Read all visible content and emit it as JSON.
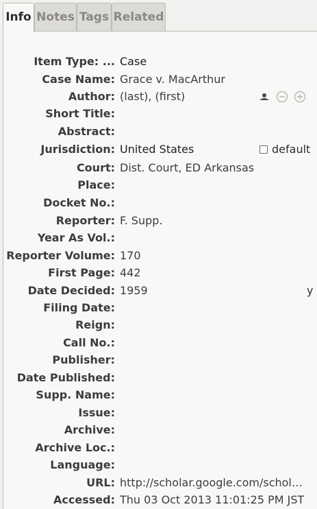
{
  "tabs": [
    {
      "label": "Info"
    },
    {
      "label": "Notes"
    },
    {
      "label": "Tags"
    },
    {
      "label": "Related"
    }
  ],
  "fields": {
    "item_type": {
      "label": "Item Type: ...",
      "value": "Case"
    },
    "case_name": {
      "label": "Case Name:",
      "value": "Grace v. MacArthur"
    },
    "author": {
      "label": "Author:",
      "value": "(last), (first)"
    },
    "short_title": {
      "label": "Short Title:",
      "value": ""
    },
    "abstract": {
      "label": "Abstract:",
      "value": ""
    },
    "jurisdiction": {
      "label": "Jurisdiction:",
      "value": "United States",
      "checkbox_label": "default"
    },
    "court": {
      "label": "Court:",
      "value": "Dist. Court, ED Arkansas"
    },
    "place": {
      "label": "Place:",
      "value": ""
    },
    "docket_no": {
      "label": "Docket No.:",
      "value": ""
    },
    "reporter": {
      "label": "Reporter:",
      "value": "F. Supp."
    },
    "year_as_vol": {
      "label": "Year As Vol.:",
      "value": ""
    },
    "reporter_volume": {
      "label": "Reporter Volume:",
      "value": "170"
    },
    "first_page": {
      "label": "First Page:",
      "value": "442"
    },
    "date_decided": {
      "label": "Date Decided:",
      "value": "1959",
      "suffix": "y"
    },
    "filing_date": {
      "label": "Filing Date:",
      "value": ""
    },
    "reign": {
      "label": "Reign:",
      "value": ""
    },
    "call_no": {
      "label": "Call No.:",
      "value": ""
    },
    "publisher": {
      "label": "Publisher:",
      "value": ""
    },
    "date_published": {
      "label": "Date Published:",
      "value": ""
    },
    "supp_name": {
      "label": "Supp. Name:",
      "value": ""
    },
    "issue": {
      "label": "Issue:",
      "value": ""
    },
    "archive": {
      "label": "Archive:",
      "value": ""
    },
    "archive_loc": {
      "label": "Archive Loc.:",
      "value": ""
    },
    "language": {
      "label": "Language:",
      "value": ""
    },
    "url": {
      "label": "URL:",
      "value": "http://scholar.google.com/schol…"
    },
    "accessed": {
      "label": "Accessed:",
      "value": "Thu 03 Oct 2013 11:01:25 PM JST"
    }
  },
  "icons": {
    "author_switch": "person-icon",
    "author_remove": "minus-circle-icon",
    "author_add": "plus-circle-icon"
  }
}
